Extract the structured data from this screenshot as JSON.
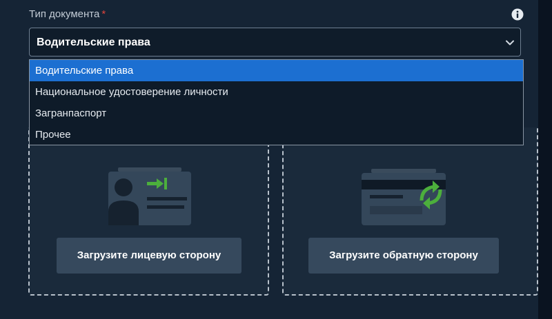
{
  "field": {
    "label": "Тип документа",
    "required_mark": "*"
  },
  "select": {
    "selected_value": "Водительские права",
    "options": [
      {
        "label": "Водительские права",
        "selected": true
      },
      {
        "label": "Национальное удостоверение личности",
        "selected": false
      },
      {
        "label": "Загранпаспорт",
        "selected": false
      },
      {
        "label": "Прочее",
        "selected": false
      }
    ]
  },
  "upload": {
    "front_label": "Загрузите лицевую сторону",
    "back_label": "Загрузите обратную сторону"
  },
  "icons": {
    "info": "info-icon",
    "chevron": "chevron-down-icon",
    "front_illustration": "id-card-front-icon",
    "back_illustration": "id-card-back-icon"
  },
  "colors": {
    "panel_bg": "#152435",
    "selected_option": "#1c6fd1",
    "required": "#e0443c",
    "accent_green": "#4caf3c",
    "button_bg": "#36495d"
  }
}
